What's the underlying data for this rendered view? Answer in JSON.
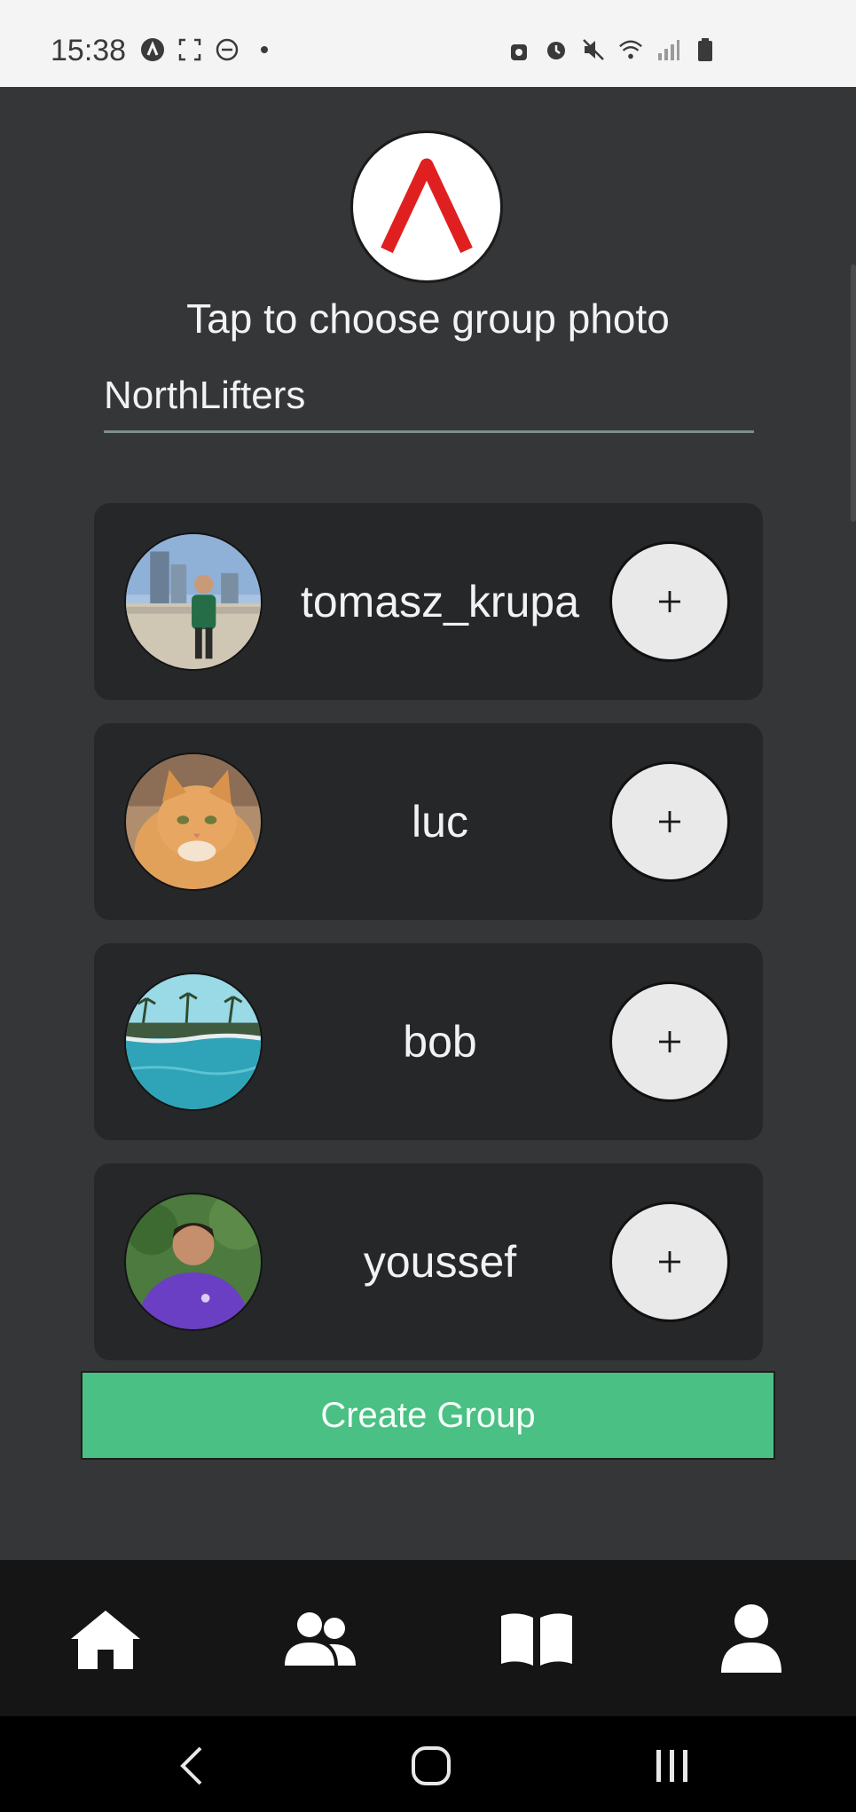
{
  "status_bar": {
    "time": "15:38"
  },
  "header": {
    "photo_prompt": "Tap to choose group photo",
    "logo_color": "#e02020"
  },
  "group_name": {
    "value": "NorthLifters"
  },
  "users": [
    {
      "username": "tomasz_krupa",
      "avatar": "person-photo-icon",
      "add_label": "+"
    },
    {
      "username": "luc",
      "avatar": "cat-photo-icon",
      "add_label": "+"
    },
    {
      "username": "bob",
      "avatar": "pool-photo-icon",
      "add_label": "+"
    },
    {
      "username": "youssef",
      "avatar": "person-photo-icon",
      "add_label": "+"
    }
  ],
  "create_button": {
    "label": "Create Group",
    "color": "#4ac085"
  },
  "tabs": [
    {
      "icon": "home-icon"
    },
    {
      "icon": "group-icon"
    },
    {
      "icon": "book-icon"
    },
    {
      "icon": "profile-icon"
    }
  ],
  "system_nav": [
    {
      "icon": "back-icon"
    },
    {
      "icon": "home-circle-icon"
    },
    {
      "icon": "recents-icon"
    }
  ]
}
